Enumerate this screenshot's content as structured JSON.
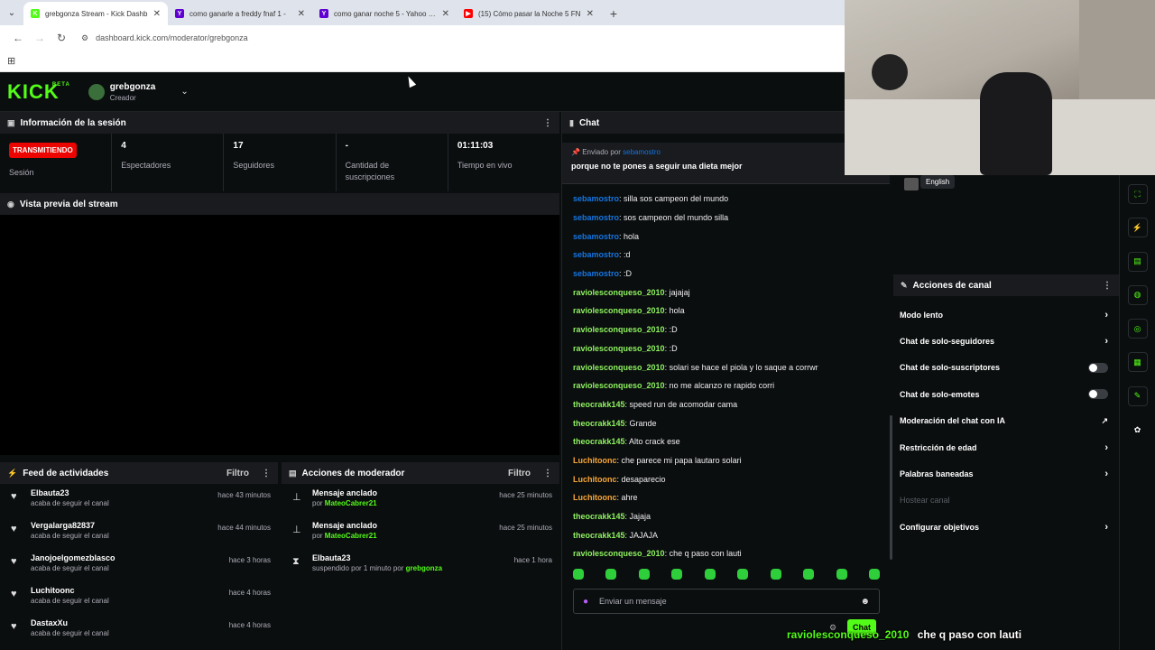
{
  "browser": {
    "tabs": [
      {
        "title": "grebgonza Stream - Kick Dashb",
        "fav_color": "#53fc18",
        "fav": "K",
        "active": true
      },
      {
        "title": "como ganarle a freddy fnaf 1 -",
        "fav_color": "#6001d2",
        "fav": "Y",
        "active": false
      },
      {
        "title": "como ganar noche 5 - Yahoo Se",
        "fav_color": "#6001d2",
        "fav": "Y",
        "active": false
      },
      {
        "title": "(15) Cómo pasar la Noche 5 FN",
        "fav_color": "#ff0000",
        "fav": "▶",
        "active": false
      }
    ],
    "url": "dashboard.kick.com/moderator/grebgonza"
  },
  "header": {
    "logo": "KICK",
    "logo_sup": "BETA",
    "username": "grebgonza",
    "role": "Creador"
  },
  "session": {
    "title": "Información de la sesión",
    "live_badge": "TRANSMITIENDO",
    "live_label": "Sesión",
    "stats": [
      {
        "value": "4",
        "label": "Espectadores"
      },
      {
        "value": "17",
        "label": "Seguidores"
      },
      {
        "value": "-",
        "label": "Cantidad de suscripciones"
      },
      {
        "value": "01:11:03",
        "label": "Tiempo en vivo"
      }
    ]
  },
  "preview": {
    "title": "Vista previa del stream"
  },
  "feed": {
    "title": "Feed de actividades",
    "filter": "Filtro",
    "items": [
      {
        "user": "Elbauta23",
        "action": "acaba de seguir el canal",
        "when": "hace 43 minutos"
      },
      {
        "user": "Vergalarga82837",
        "action": "acaba de seguir el canal",
        "when": "hace 44 minutos"
      },
      {
        "user": "Janojoelgomezblasco",
        "action": "acaba de seguir el canal",
        "when": "hace 3 horas"
      },
      {
        "user": "Luchitoonc",
        "action": "acaba de seguir el canal",
        "when": "hace 4 horas"
      },
      {
        "user": "DastaxXu",
        "action": "acaba de seguir el canal",
        "when": "hace 4 horas"
      }
    ]
  },
  "mods": {
    "title": "Acciones de moderador",
    "filter": "Filtro",
    "items": [
      {
        "title": "Mensaje anclado",
        "prefix": "por",
        "user": "MateoCabrer21",
        "suffix": "",
        "suffix_user": "",
        "when": "hace 25 minutos",
        "icon": "pin"
      },
      {
        "title": "Mensaje anclado",
        "prefix": "por",
        "user": "MateoCabrer21",
        "suffix": "",
        "suffix_user": "",
        "when": "hace 25 minutos",
        "icon": "pin"
      },
      {
        "title": "Elbauta23",
        "prefix": "suspendido por 1 minuto por",
        "user": "grebgonza",
        "suffix": "",
        "suffix_user": "",
        "when": "hace 1 hora",
        "icon": "hourglass"
      }
    ]
  },
  "chat": {
    "title": "Chat",
    "pinned": {
      "by_label": "Enviado por",
      "by_user": "sebamostro",
      "message": "porque no te pones a seguir una dieta mejor"
    },
    "messages": [
      {
        "user": "sebamostro",
        "text": ": silla sos campeon del mundo",
        "color": "#1475e1"
      },
      {
        "user": "sebamostro",
        "text": ": sos campeon del mundo silla",
        "color": "#1475e1"
      },
      {
        "user": "sebamostro",
        "text": ": hola",
        "color": "#1475e1"
      },
      {
        "user": "sebamostro",
        "text": ": :d",
        "color": "#1475e1"
      },
      {
        "user": "sebamostro",
        "text": ": :D",
        "color": "#1475e1"
      },
      {
        "user": "raviolesconqueso_2010",
        "text": ": jajajaj",
        "color": "#8ef25f"
      },
      {
        "user": "raviolesconqueso_2010",
        "text": ": hola",
        "color": "#8ef25f"
      },
      {
        "user": "raviolesconqueso_2010",
        "text": ": :D",
        "color": "#8ef25f"
      },
      {
        "user": "raviolesconqueso_2010",
        "text": ": :D",
        "color": "#8ef25f"
      },
      {
        "user": "raviolesconqueso_2010",
        "text": ": solari se hace el piola y lo saque a corrwr",
        "color": "#8ef25f"
      },
      {
        "user": "raviolesconqueso_2010",
        "text": ": no me alcanzo re rapido corri",
        "color": "#8ef25f"
      },
      {
        "user": "theocrakk145",
        "text": ": speed run de acomodar cama",
        "color": "#8ef25f"
      },
      {
        "user": "theocrakk145",
        "text": ": Grande",
        "color": "#8ef25f"
      },
      {
        "user": "theocrakk145",
        "text": ": Alto crack ese",
        "color": "#8ef25f"
      },
      {
        "user": "Luchitoonc",
        "text": ": che parece mi papa lautaro solari",
        "color": "#f8a637"
      },
      {
        "user": "Luchitoonc",
        "text": ": desaparecio",
        "color": "#f8a637"
      },
      {
        "user": "Luchitoonc",
        "text": ": ahre",
        "color": "#f8a637"
      },
      {
        "user": "theocrakk145",
        "text": ": Jajaja",
        "color": "#8ef25f"
      },
      {
        "user": "theocrakk145",
        "text": ": JAJAJA",
        "color": "#8ef25f"
      },
      {
        "user": "raviolesconqueso_2010",
        "text": ": che q paso con lauti",
        "color": "#8ef25f"
      }
    ],
    "input_placeholder": "Enviar un mensaje",
    "send_label": "Chat"
  },
  "language": {
    "label": "English"
  },
  "channel_actions": {
    "title": "Acciones de canal",
    "items": [
      {
        "label": "Modo lento",
        "control": "chevron"
      },
      {
        "label": "Chat de solo-seguidores",
        "control": "chevron"
      },
      {
        "label": "Chat de solo-suscriptores",
        "control": "toggle"
      },
      {
        "label": "Chat de solo-emotes",
        "control": "toggle"
      },
      {
        "label": "Moderación del chat con IA",
        "control": "external"
      },
      {
        "label": "Restricción de edad",
        "control": "chevron"
      },
      {
        "label": "Palabras baneadas",
        "control": "chevron"
      },
      {
        "label": "Hostear canal",
        "control": "disabled"
      },
      {
        "label": "Configurar objetivos",
        "control": "chevron"
      }
    ]
  },
  "overlay": {
    "user": "raviolesconqueso_2010",
    "text": "che q paso con lauti"
  },
  "colors": {
    "kick_green": "#53fc18",
    "live_red": "#eb0400",
    "bg": "#0b0e0f",
    "panel_head": "#191b1f"
  }
}
